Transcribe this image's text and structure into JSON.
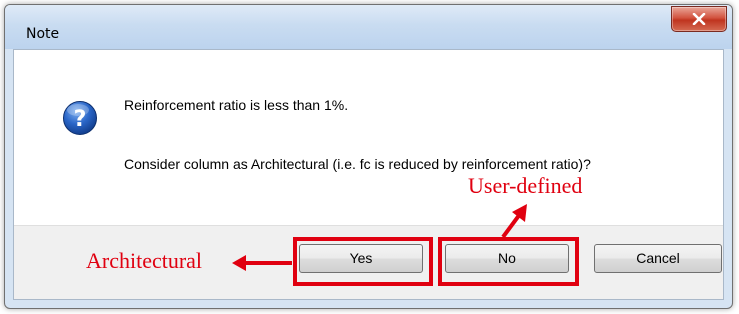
{
  "window": {
    "title": "Note"
  },
  "message": {
    "line1": "Reinforcement ratio is less than 1%.",
    "line2": "Consider column as Architectural (i.e. fc is reduced by reinforcement ratio)?"
  },
  "buttons": {
    "yes": "Yes",
    "no": "No",
    "cancel": "Cancel"
  },
  "annotations": {
    "architectural": "Architectural",
    "user_defined": "User-defined",
    "color": "#e00010"
  },
  "icons": {
    "message": "question-icon",
    "close": "close-icon"
  }
}
